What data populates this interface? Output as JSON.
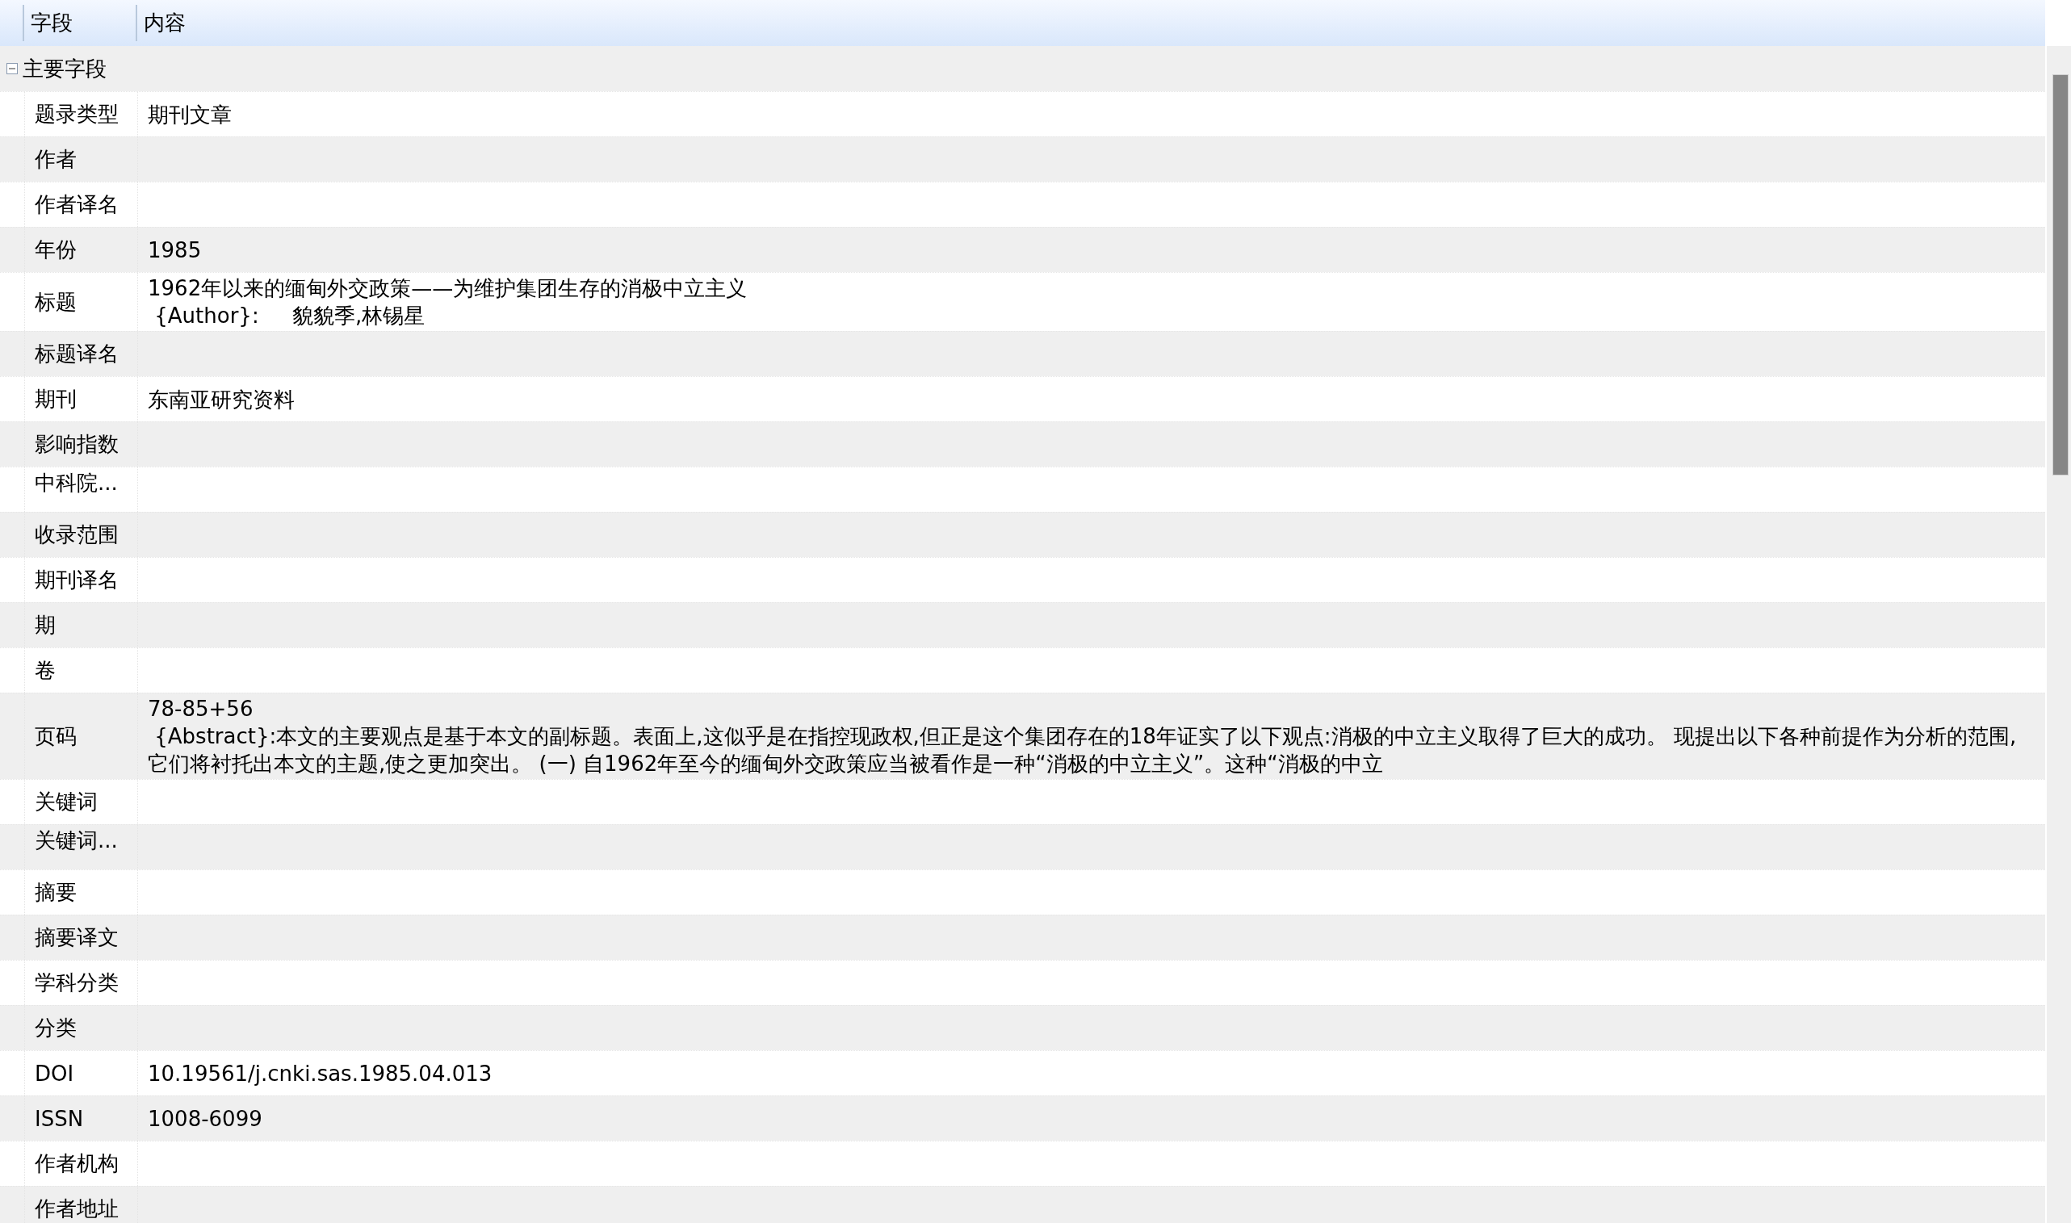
{
  "table": {
    "columns": [
      "字段",
      "内容"
    ],
    "groups": [
      {
        "label": "主要字段",
        "expanded": true,
        "rows": [
          {
            "field": "题录类型",
            "value": [
              "期刊文章"
            ]
          },
          {
            "field": "作者",
            "value": []
          },
          {
            "field": "作者译名",
            "value": []
          },
          {
            "field": "年份",
            "value": [
              "1985"
            ]
          },
          {
            "field": "标题",
            "value": [
              "1962年以来的缅甸外交政策——为维护集团生存的消极中立主义",
              " {Author}:     貌貌季,林锡星"
            ]
          },
          {
            "field": "标题译名",
            "value": []
          },
          {
            "field": "期刊",
            "value": [
              "东南亚研究资料"
            ]
          },
          {
            "field": "影响指数",
            "value": []
          },
          {
            "field": "中科院...",
            "kind": "clipped",
            "value": []
          },
          {
            "field": "收录范围",
            "value": []
          },
          {
            "field": "期刊译名",
            "value": []
          },
          {
            "field": "期",
            "value": []
          },
          {
            "field": "卷",
            "value": []
          },
          {
            "field": "页码",
            "value": [
              "78-85+56",
              " {Abstract}:本文的主要观点是基于本文的副标题。表面上,这似乎是在指控现政权,但正是这个集团存在的18年证实了以下观点:消极的中立主义取得了巨大的成功。 现提出以下各种前提作为分析的范围,它们将衬托出本文的主题,使之更加突出。 (一) 自1962年至今的缅甸外交政策应当被看作是一种“消极的中立主义”。这种“消极的中立"
            ]
          },
          {
            "field": "关键词",
            "value": []
          },
          {
            "field": "关键词...",
            "kind": "clipped",
            "value": []
          },
          {
            "field": "摘要",
            "value": []
          },
          {
            "field": "摘要译文",
            "value": []
          },
          {
            "field": "学科分类",
            "value": []
          },
          {
            "field": "分类",
            "value": []
          },
          {
            "field": "DOI",
            "value": [
              "10.19561/j.cnki.sas.1985.04.013"
            ]
          },
          {
            "field": "ISSN",
            "value": [
              "1008-6099"
            ]
          },
          {
            "field": "作者机构",
            "value": []
          },
          {
            "field": "作者地址",
            "value": []
          }
        ]
      }
    ]
  }
}
